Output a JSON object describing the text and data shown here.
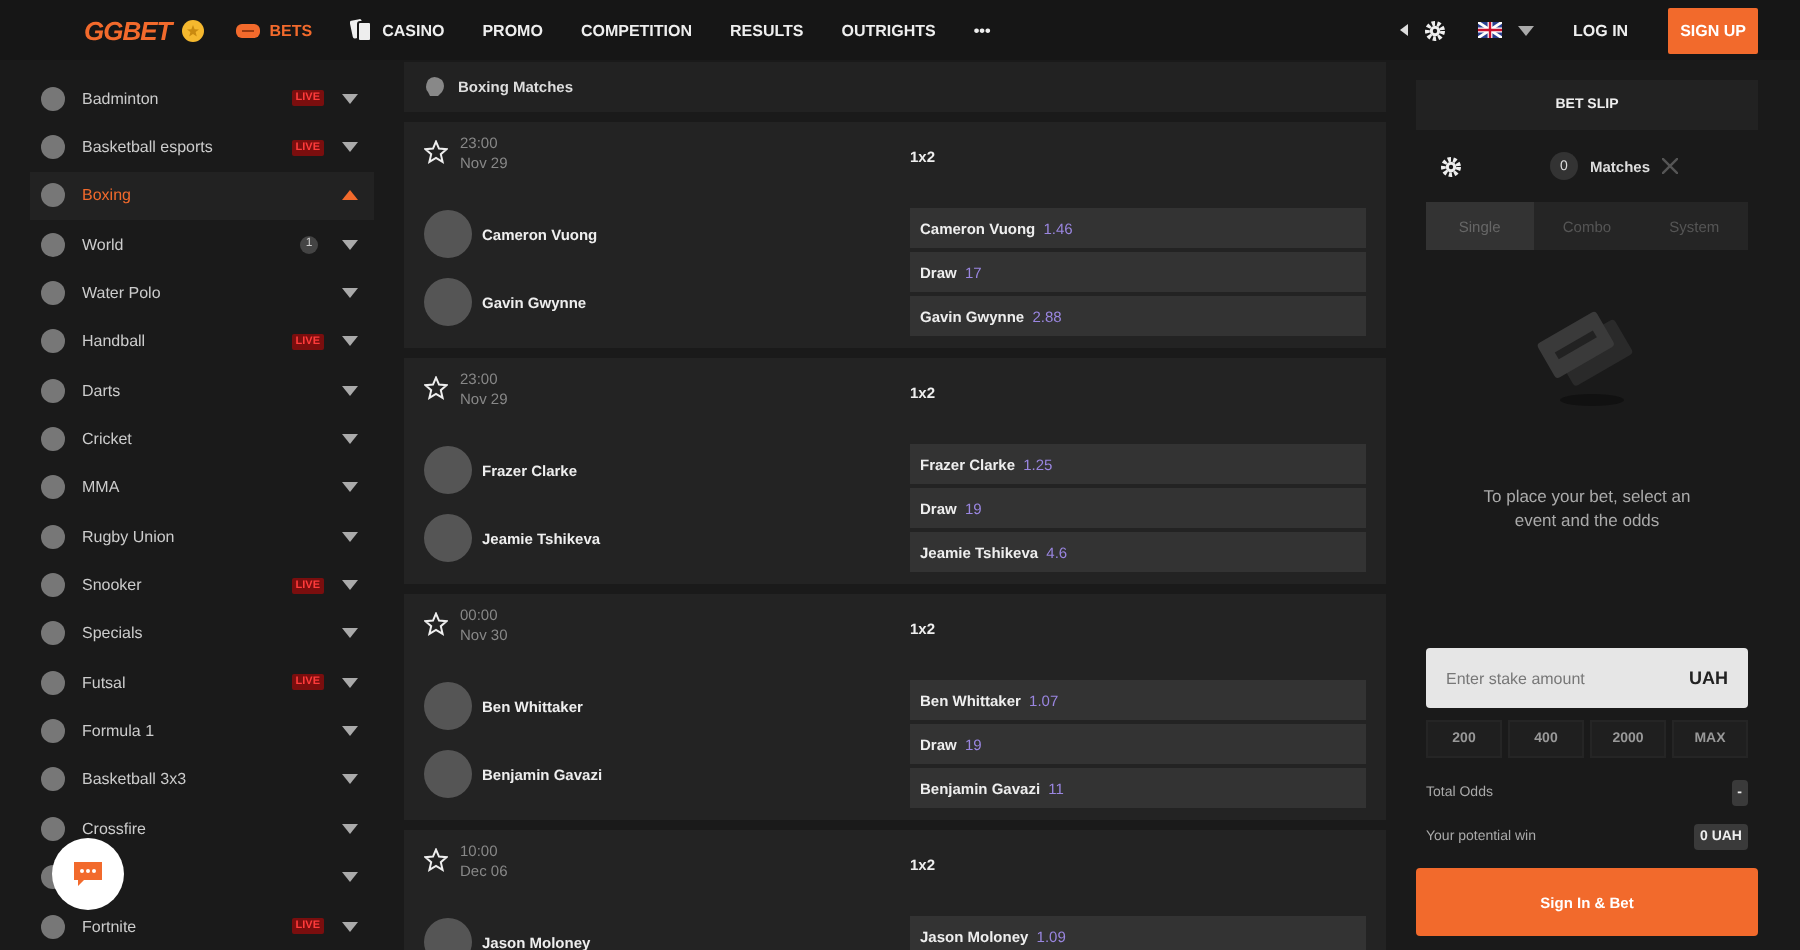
{
  "header": {
    "logo": "GGBET",
    "nav": [
      {
        "label": "BETS",
        "kind": "bets",
        "selected": true
      },
      {
        "label": "CASINO",
        "kind": "casino",
        "selected": false
      },
      {
        "label": "PROMO",
        "kind": "plain",
        "selected": false
      },
      {
        "label": "COMPETITION",
        "kind": "plain",
        "selected": false
      },
      {
        "label": "RESULTS",
        "kind": "plain",
        "selected": false
      },
      {
        "label": "OUTRIGHTS",
        "kind": "plain",
        "selected": false
      },
      {
        "label": "•••",
        "kind": "plain",
        "selected": false
      }
    ],
    "login": "LOG IN",
    "signup": "SIGN UP"
  },
  "sidebar": {
    "items": [
      {
        "label": "Badminton",
        "badge": "LIVE",
        "selected": false,
        "expanded": false
      },
      {
        "label": "Basketball esports",
        "badge": "LIVE",
        "selected": false,
        "expanded": false
      },
      {
        "label": "Boxing",
        "selected": true,
        "expanded": true
      },
      {
        "label": "World",
        "count": "1",
        "selected": false,
        "expanded": false
      },
      {
        "label": "Water Polo",
        "selected": false,
        "expanded": false
      },
      {
        "label": "Handball",
        "badge": "LIVE",
        "selected": false,
        "expanded": false
      },
      {
        "label": "Darts",
        "selected": false,
        "expanded": false
      },
      {
        "label": "Cricket",
        "selected": false,
        "expanded": false
      },
      {
        "label": "MMA",
        "selected": false,
        "expanded": false
      },
      {
        "label": "Rugby Union",
        "selected": false,
        "expanded": false
      },
      {
        "label": "Snooker",
        "badge": "LIVE",
        "selected": false,
        "expanded": false
      },
      {
        "label": "Specials",
        "selected": false,
        "expanded": false
      },
      {
        "label": "Futsal",
        "badge": "LIVE",
        "selected": false,
        "expanded": false
      },
      {
        "label": "Formula 1",
        "selected": false,
        "expanded": false
      },
      {
        "label": "Basketball 3x3",
        "selected": false,
        "expanded": false
      },
      {
        "label": "Crossfire",
        "selected": false,
        "expanded": false
      },
      {
        "expanded": false
      },
      {
        "label": "Fortnite",
        "badge": "LIVE",
        "selected": false,
        "expanded": false
      }
    ]
  },
  "section_title": "Boxing Matches",
  "matches": [
    {
      "time": "23:00",
      "date": "Nov 29",
      "market": "1x2",
      "fighters": [
        "Cameron Vuong",
        "Gavin Gwynne"
      ],
      "odds": [
        {
          "label": "Cameron Vuong",
          "value": "1.46"
        },
        {
          "label": "Draw",
          "value": "17"
        },
        {
          "label": "Gavin Gwynne",
          "value": "2.88"
        }
      ]
    },
    {
      "time": "23:00",
      "date": "Nov 29",
      "market": "1x2",
      "fighters": [
        "Frazer Clarke",
        "Jeamie Tshikeva"
      ],
      "odds": [
        {
          "label": "Frazer Clarke",
          "value": "1.25"
        },
        {
          "label": "Draw",
          "value": "19"
        },
        {
          "label": "Jeamie Tshikeva",
          "value": "4.6"
        }
      ]
    },
    {
      "time": "00:00",
      "date": "Nov 30",
      "market": "1x2",
      "fighters": [
        "Ben Whittaker",
        "Benjamin Gavazi"
      ],
      "odds": [
        {
          "label": "Ben Whittaker",
          "value": "1.07"
        },
        {
          "label": "Draw",
          "value": "19"
        },
        {
          "label": "Benjamin Gavazi",
          "value": "11"
        }
      ]
    },
    {
      "time": "10:00",
      "date": "Dec 06",
      "market": "1x2",
      "fighters": [
        "Jason Moloney"
      ],
      "odds": [
        {
          "label": "Jason Moloney",
          "value": "1.09"
        }
      ]
    }
  ],
  "bet_slip": {
    "title": "BET SLIP",
    "count": "0",
    "matches_label": "Matches",
    "tabs": [
      {
        "label": "Single",
        "selected": true
      },
      {
        "label": "Combo",
        "selected": false
      },
      {
        "label": "System",
        "selected": false
      }
    ],
    "message": "To place your bet, select an event and the odds",
    "stake_placeholder": "Enter stake amount",
    "currency": "UAH",
    "quick_amounts": [
      "200",
      "400",
      "2000",
      "MAX"
    ],
    "total_odds_label": "Total Odds",
    "total_odds": "-",
    "potential_win_label": "Your potential win",
    "potential_win": "0 UAH",
    "submit": "Sign In & Bet"
  }
}
